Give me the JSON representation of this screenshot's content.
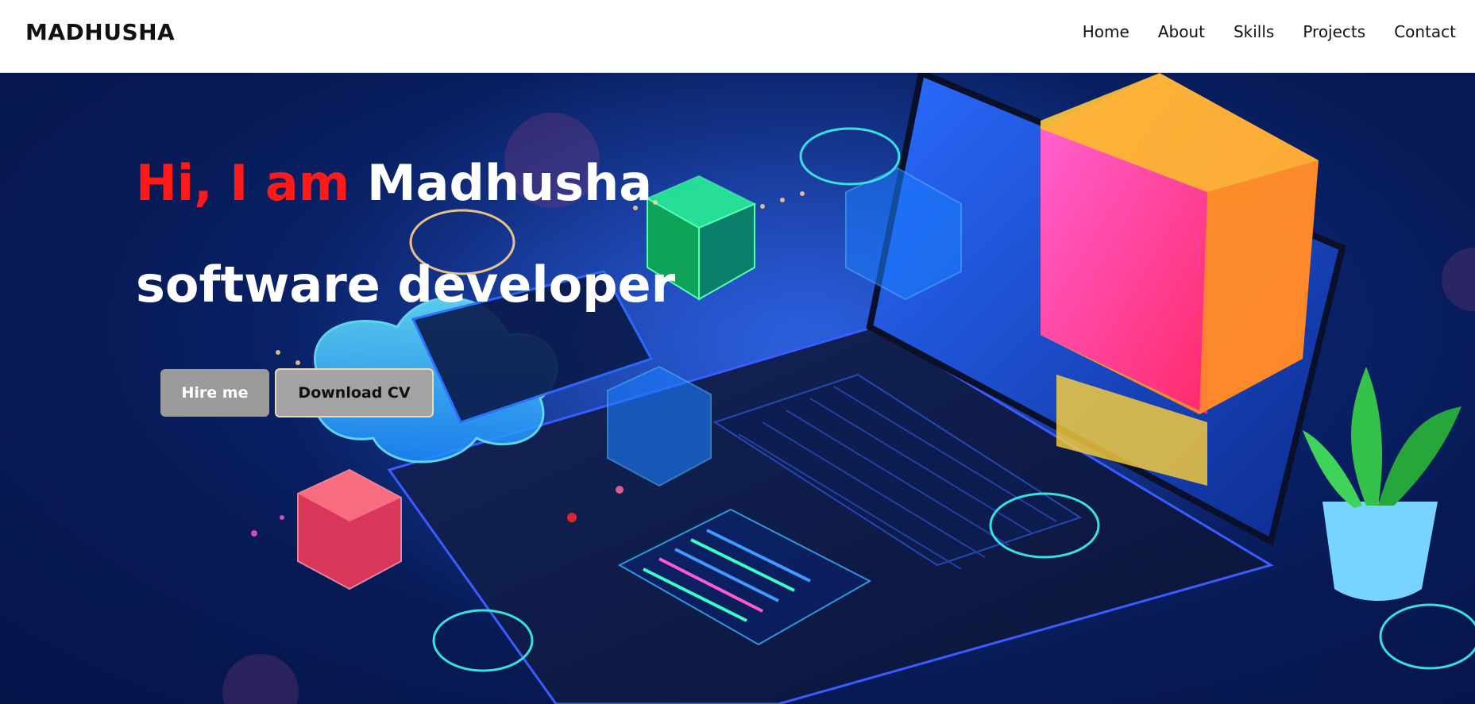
{
  "header": {
    "brand": "MADHUSHA",
    "nav": [
      {
        "label": "Home"
      },
      {
        "label": "About"
      },
      {
        "label": "Skills"
      },
      {
        "label": "Projects"
      },
      {
        "label": "Contact"
      }
    ]
  },
  "hero": {
    "greeting": "Hi, I am",
    "name": "Madhusha",
    "role": "software developer",
    "hire_label": "Hire me",
    "cv_label": "Download CV",
    "illustration": "isometric-laptop-cloud-cubes-illustration",
    "colors": {
      "accent": "#ff1a1a",
      "hero_bg": "#0b2470",
      "button_bg": "#9a9a9a"
    }
  }
}
